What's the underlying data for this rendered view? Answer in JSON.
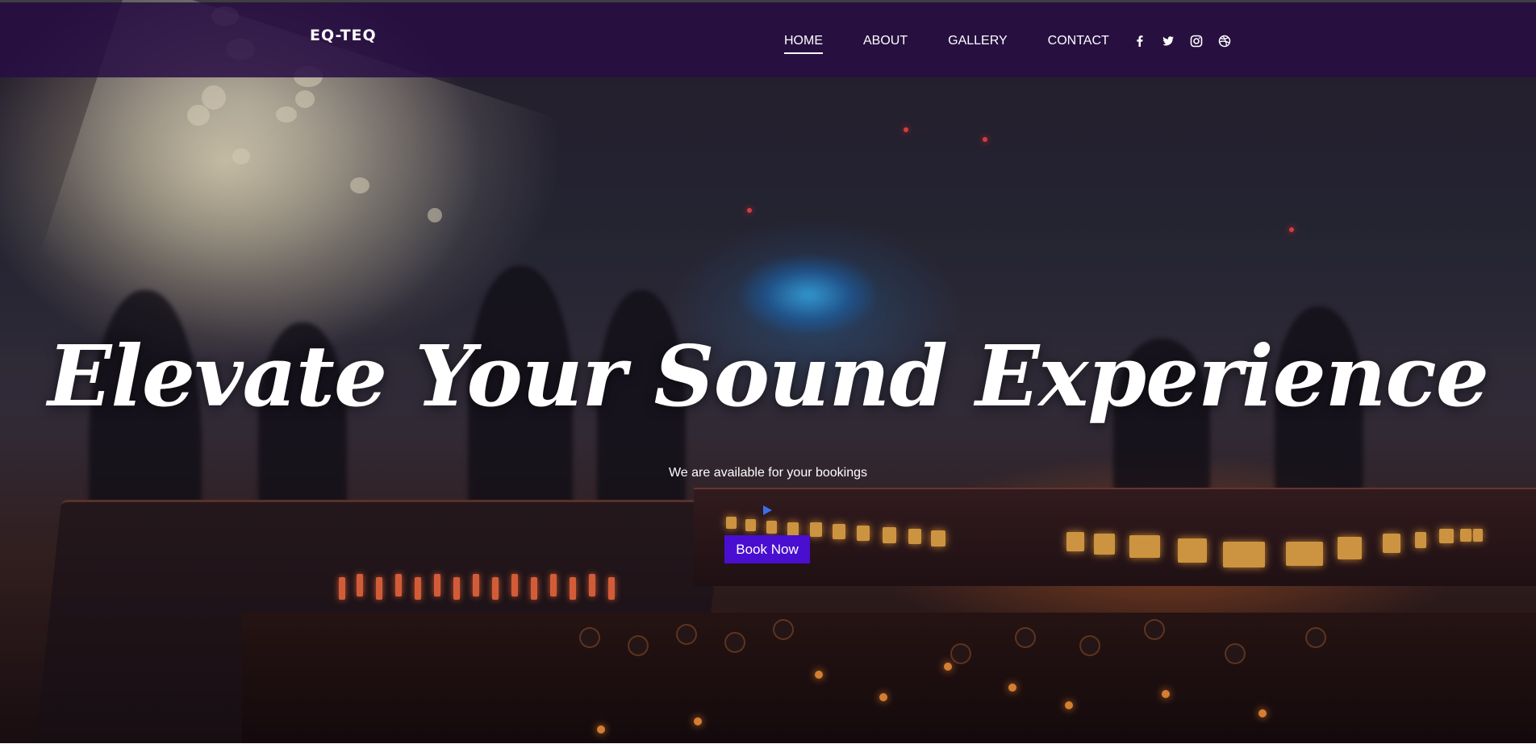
{
  "brand": {
    "logo_text": "EQ-TEQ"
  },
  "nav": {
    "items": [
      {
        "label": "HOME",
        "active": true
      },
      {
        "label": "ABOUT",
        "active": false
      },
      {
        "label": "GALLERY",
        "active": false
      },
      {
        "label": "CONTACT",
        "active": false
      }
    ]
  },
  "social": {
    "icons": [
      "facebook-icon",
      "twitter-icon",
      "instagram-icon",
      "dribbble-icon"
    ]
  },
  "hero": {
    "headline": "Elevate Your Sound Experience",
    "subheadline": "We are available for your bookings",
    "cta_label": "Book Now"
  },
  "colors": {
    "navbar_bg": "#280e44",
    "cta_bg": "#4a0ed0",
    "play_icon": "#3b6fe8",
    "text": "#ffffff"
  }
}
